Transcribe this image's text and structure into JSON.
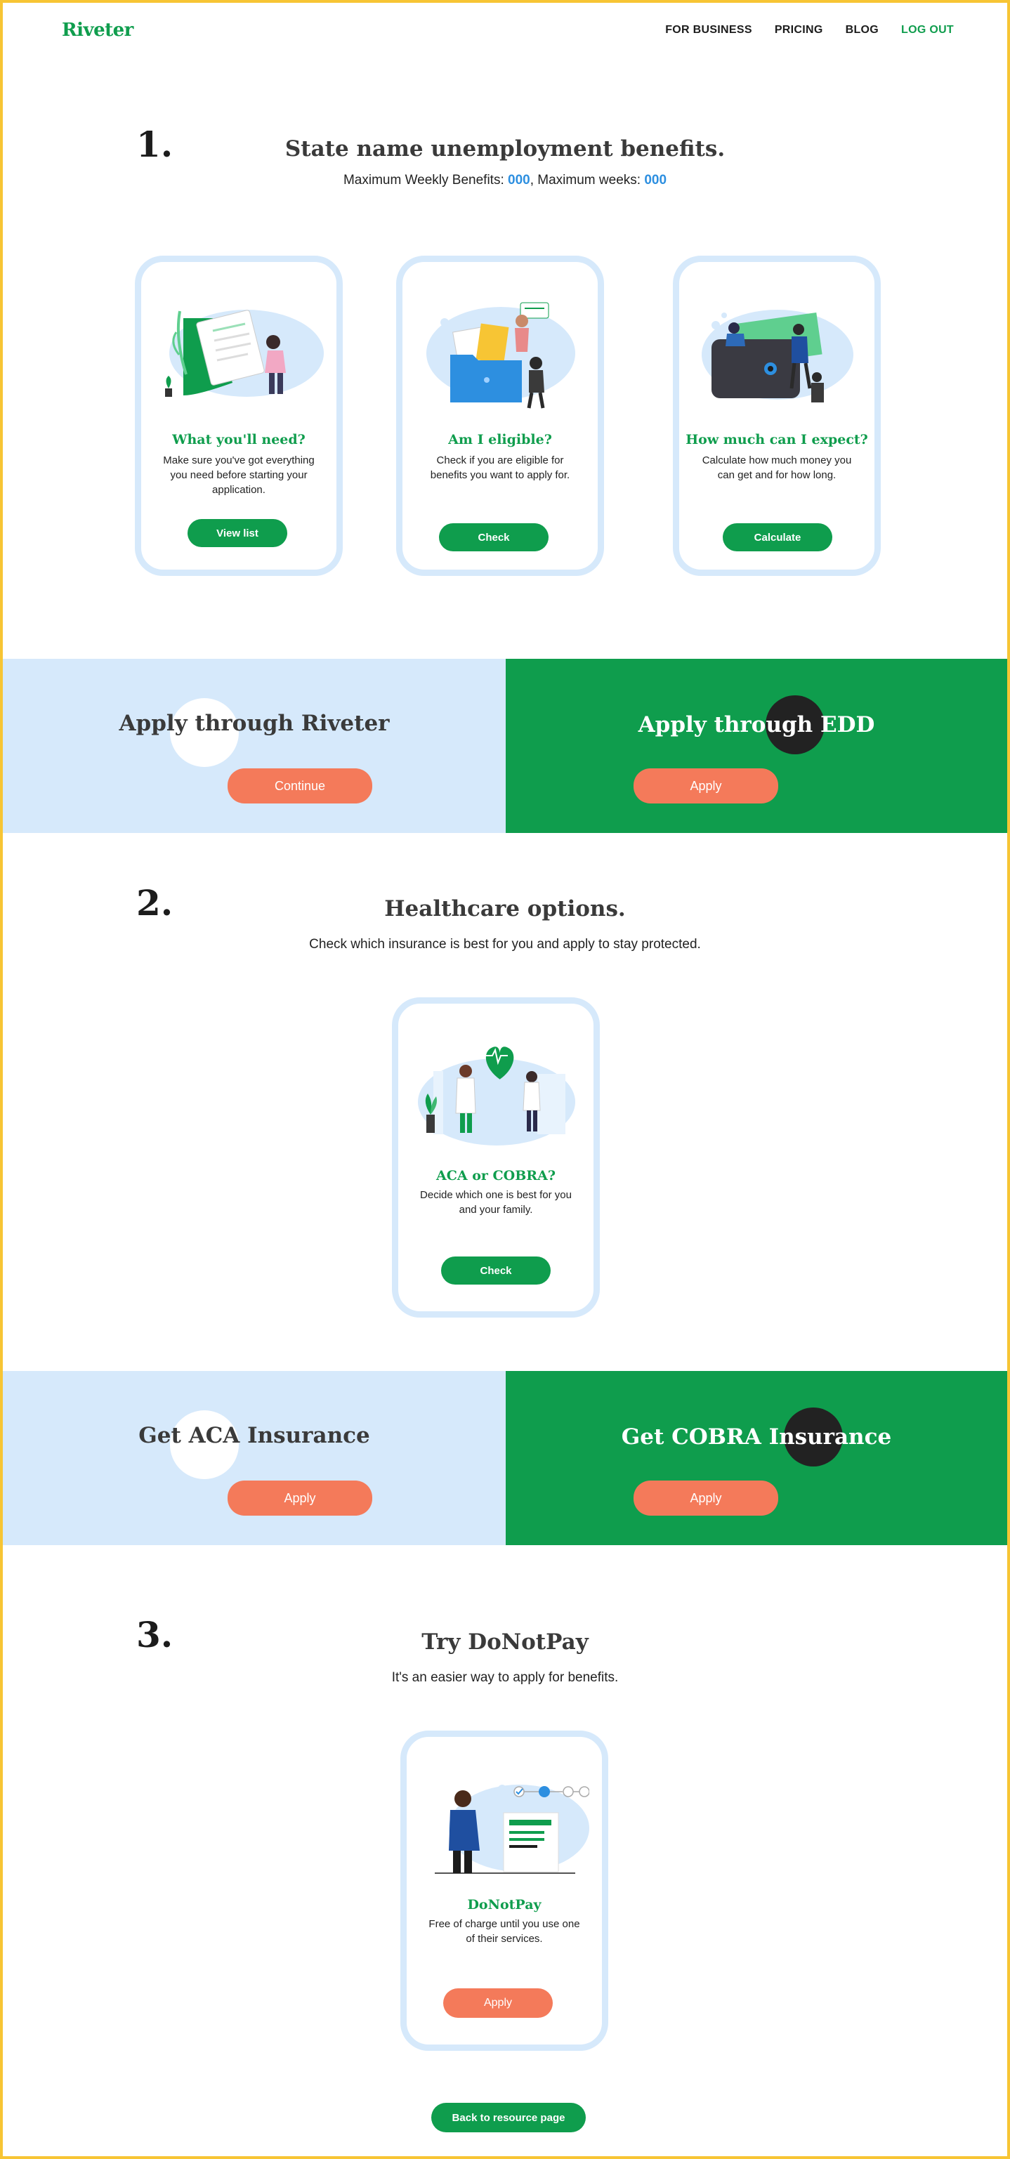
{
  "nav": {
    "logo": "Riveter",
    "items": [
      "FOR BUSINESS",
      "PRICING",
      "BLOG"
    ],
    "logout": "LOG OUT"
  },
  "section1": {
    "number": "1.",
    "title": "State name unemployment benefits.",
    "subtitle_prefix": "Maximum Weekly Benefits: ",
    "max_weekly": "000",
    "subtitle_mid": ", Maximum weeks: ",
    "max_weeks": "000",
    "cards": [
      {
        "title": "What you'll need?",
        "desc": "Make sure you've got everything you need before starting your application.",
        "button": "View list"
      },
      {
        "title": "Am I eligible?",
        "desc": "Check if you are eligible for benefits you want to apply for.",
        "button": "Check"
      },
      {
        "title": "How much can I expect?",
        "desc": "Calculate how much money you can get and for how long.",
        "button": "Calculate"
      }
    ]
  },
  "band1": {
    "left_title": "Apply through Riveter",
    "left_button": "Continue",
    "right_title": "Apply through EDD",
    "right_button": "Apply"
  },
  "section2": {
    "number": "2.",
    "title": "Healthcare options.",
    "subtitle": "Check which insurance is best for you and apply to stay protected.",
    "card": {
      "title": "ACA or COBRA?",
      "desc": "Decide which one is best for you and your family.",
      "button": "Check"
    }
  },
  "band2": {
    "left_title": "Get ACA Insurance",
    "left_button": "Apply",
    "right_title": "Get COBRA Insurance",
    "right_button": "Apply"
  },
  "section3": {
    "number": "3.",
    "title": "Try DoNotPay",
    "subtitle": "It's an easier way to apply for benefits.",
    "card": {
      "title": "DoNotPay",
      "desc": "Free of charge until you use one of their services.",
      "button": "Apply"
    }
  },
  "footer": {
    "back_button": "Back to resource page"
  },
  "colors": {
    "brand_green": "#0f9d4d",
    "light_blue": "#d6e9fb",
    "accent_orange": "#f47a5a",
    "value_blue": "#2d8fe0",
    "frame_yellow": "#f7c534"
  }
}
